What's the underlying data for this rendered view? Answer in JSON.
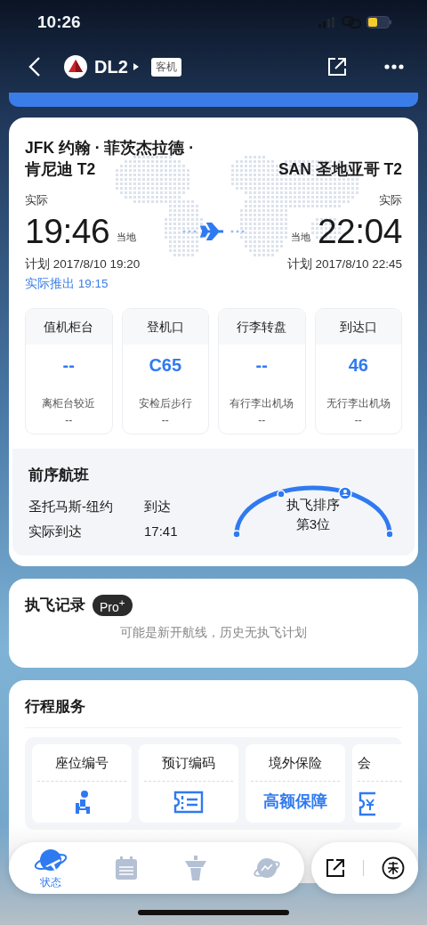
{
  "status_bar": {
    "time": "10:26"
  },
  "header": {
    "flight": "DL2",
    "aircraft_tag": "客机"
  },
  "departure": {
    "airport": "JFK 约翰 · 菲茨杰拉德 · 肯尼迪 T2",
    "status_label": "实际",
    "time": "19:46",
    "time_note": "当地",
    "scheduled": "计划 2017/8/10 19:20",
    "pushback": "实际推出 19:15"
  },
  "arrival": {
    "airport": "SAN 圣地亚哥 T2",
    "status_label": "实际",
    "time": "22:04",
    "time_note": "当地",
    "scheduled": "计划 2017/8/10 22:45"
  },
  "tiles": [
    {
      "title": "值机柜台",
      "value": "--",
      "note": "离柜台较近",
      "note_value": "--"
    },
    {
      "title": "登机口",
      "value": "C65",
      "note": "安检后步行",
      "note_value": "--"
    },
    {
      "title": "行李转盘",
      "value": "--",
      "note": "有行李出机场",
      "note_value": "--"
    },
    {
      "title": "到达口",
      "value": "46",
      "note": "无行李出机场",
      "note_value": "--"
    }
  ],
  "previous_flight": {
    "title": "前序航班",
    "rows": [
      {
        "label": "圣托马斯-纽约",
        "value": "到达"
      },
      {
        "label": "实际到达",
        "value": "17:41"
      }
    ],
    "order_title": "执飞排序",
    "order_rank": "第3位"
  },
  "history": {
    "title": "执飞记录",
    "badge": "Pro$^{+}$",
    "message": "可能是新开航线，历史无执飞计划"
  },
  "services": {
    "title": "行程服务",
    "items": [
      {
        "title": "座位编号",
        "kind": "seat"
      },
      {
        "title": "预订编码",
        "kind": "ticket"
      },
      {
        "title": "境外保险",
        "kind": "text",
        "value": "高额保障"
      },
      {
        "title": "会",
        "kind": "voucher"
      }
    ]
  },
  "bottom_bar": {
    "tabs": [
      {
        "label": "状态",
        "selected": true
      },
      {
        "selected": false
      },
      {
        "selected": false
      },
      {
        "selected": false
      }
    ]
  }
}
